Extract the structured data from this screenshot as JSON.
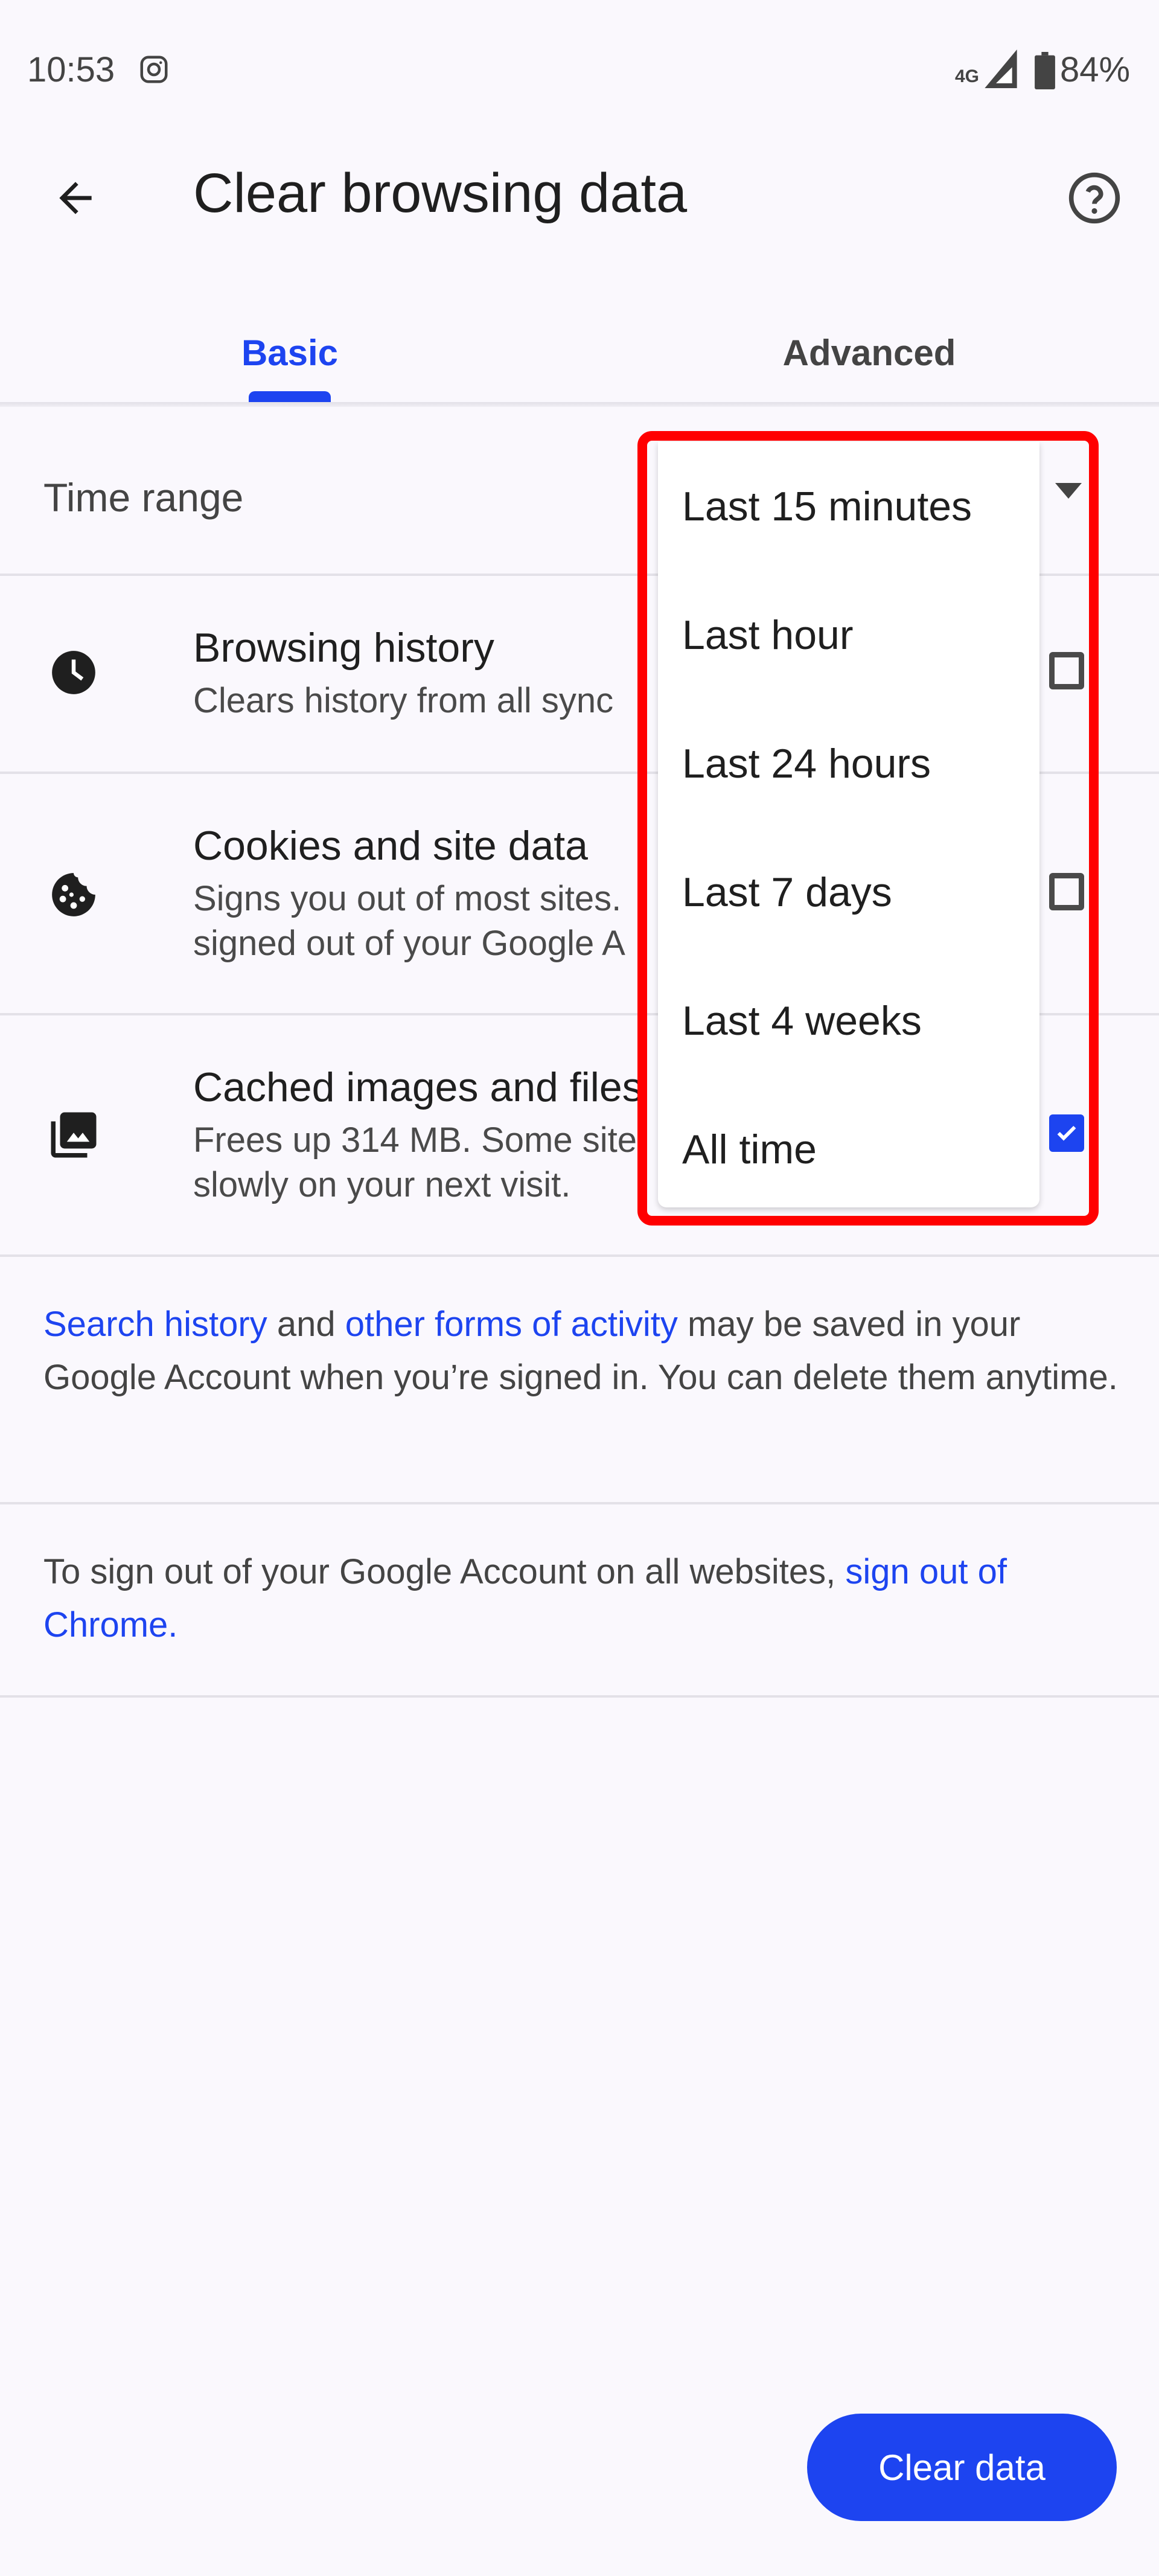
{
  "status_bar": {
    "time": "10:53",
    "notification_icon": "instagram-icon",
    "network": "4G",
    "signal_icon": "signal-icon",
    "battery_icon": "battery-icon",
    "battery_percent": "84%"
  },
  "toolbar": {
    "back_icon": "arrow-back-icon",
    "title": "Clear browsing data",
    "help_icon": "help-circle-icon"
  },
  "tabs": [
    {
      "label": "Basic",
      "selected": true
    },
    {
      "label": "Advanced",
      "selected": false
    }
  ],
  "time_range": {
    "label": "Time range",
    "selected": "Last 15 minutes",
    "options": [
      "Last 15 minutes",
      "Last hour",
      "Last 24 hours",
      "Last 7 days",
      "Last 4 weeks",
      "All time"
    ]
  },
  "options": [
    {
      "icon": "clock-icon",
      "title": "Browsing history",
      "subtitle_lines": [
        "Clears history from all sync"
      ],
      "checked": false
    },
    {
      "icon": "cookie-icon",
      "title": "Cookies and site data",
      "subtitle_lines": [
        "Signs you out of most sites.",
        "signed out of your Google A"
      ],
      "checked": false
    },
    {
      "icon": "image-stack-icon",
      "title": "Cached images and files",
      "subtitle_lines": [
        "Frees up 314 MB. Some site",
        "slowly on your next visit."
      ],
      "checked": true
    }
  ],
  "info": {
    "activity": {
      "link1": "Search history",
      "text1": " and ",
      "link2": "other forms of activity",
      "text2": " may be saved in your Google Account when you’re signed in. You can delete them anytime."
    },
    "signout": {
      "text": "To sign out of your Google Account on all websites, ",
      "link": "sign out of Chrome",
      "end": "."
    }
  },
  "clear_button": {
    "label": "Clear data"
  },
  "colors": {
    "accent": "#1d44f0",
    "highlight_box": "#ff0000",
    "background": "#faf8fd"
  }
}
